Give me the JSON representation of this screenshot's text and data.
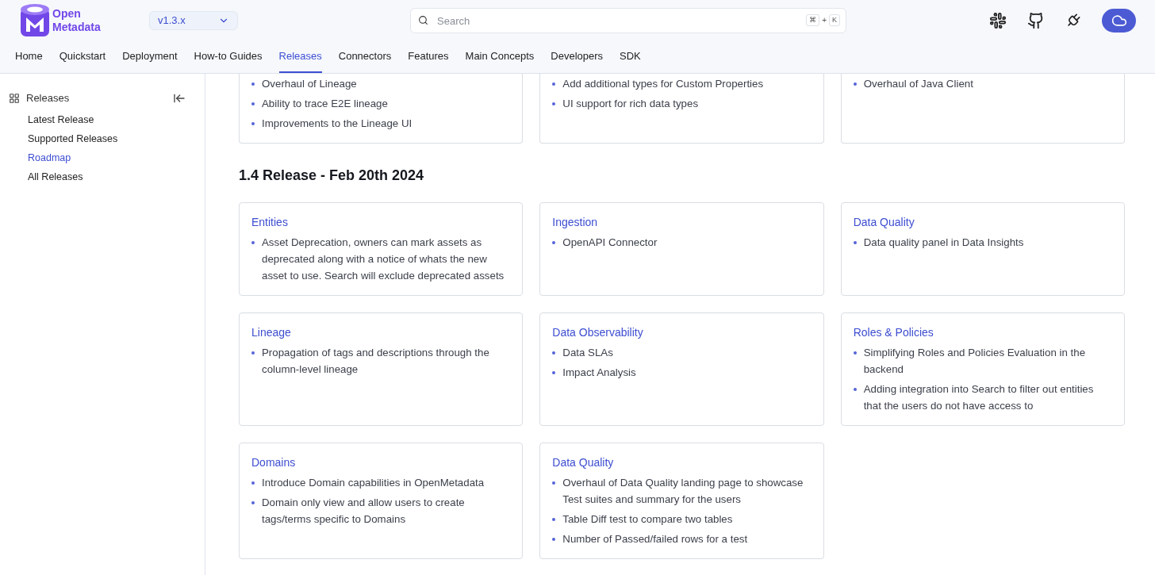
{
  "logo": {
    "line1": "Open",
    "line2": "Metadata"
  },
  "version": "v1.3.x",
  "search": {
    "placeholder": "Search",
    "keys": [
      "⌘",
      "+",
      "K"
    ]
  },
  "nav": [
    {
      "label": "Home",
      "selected": false
    },
    {
      "label": "Quickstart",
      "selected": false
    },
    {
      "label": "Deployment",
      "selected": false
    },
    {
      "label": "How-to Guides",
      "selected": false
    },
    {
      "label": "Releases",
      "selected": true
    },
    {
      "label": "Connectors",
      "selected": false
    },
    {
      "label": "Features",
      "selected": false
    },
    {
      "label": "Main Concepts",
      "selected": false
    },
    {
      "label": "Developers",
      "selected": false
    },
    {
      "label": "SDK",
      "selected": false
    }
  ],
  "sidebar": {
    "title": "Releases",
    "items": [
      {
        "label": "Latest Release",
        "selected": false
      },
      {
        "label": "Supported Releases",
        "selected": false
      },
      {
        "label": "Roadmap",
        "selected": true
      },
      {
        "label": "All Releases",
        "selected": false
      }
    ]
  },
  "sections": [
    {
      "cards": [
        {
          "items": [
            "Overhaul of Lineage",
            "Ability to trace E2E lineage",
            "Improvements to the Lineage UI"
          ]
        },
        {
          "items": [
            "Add additional types for Custom Properties",
            "UI support for rich data types"
          ]
        },
        {
          "items": [
            "Overhaul of Java Client"
          ]
        }
      ]
    },
    {
      "title": "1.4 Release - Feb 20th 2024",
      "cards": [
        {
          "title": "Entities",
          "items": [
            "Asset Deprecation, owners can mark assets as deprecated along with a notice of whats the new asset to use. Search will exclude deprecated assets"
          ]
        },
        {
          "title": "Ingestion",
          "items": [
            "OpenAPI Connector"
          ]
        },
        {
          "title": "Data Quality",
          "items": [
            "Data quality panel in Data Insights"
          ]
        },
        {
          "title": "Lineage",
          "items": [
            "Propagation of tags and descriptions through the column-level lineage"
          ]
        },
        {
          "title": "Data Observability",
          "items": [
            "Data SLAs",
            "Impact Analysis"
          ]
        },
        {
          "title": "Roles & Policies",
          "items": [
            "Simplifying Roles and Policies Evaluation in the backend",
            "Adding integration into Search to filter out entities that the users do not have access to"
          ]
        },
        {
          "title": "Domains",
          "items": [
            "Introduce Domain capabilities in OpenMetadata",
            "Domain only view and allow users to create tags/terms specific to Domains"
          ]
        },
        {
          "title": "Data Quality",
          "items": [
            "Overhaul of Data Quality landing page to showcase Test suites and summary for the users",
            "Table Diff test to compare two tables",
            "Number of Passed/failed rows for a test"
          ]
        }
      ]
    }
  ]
}
